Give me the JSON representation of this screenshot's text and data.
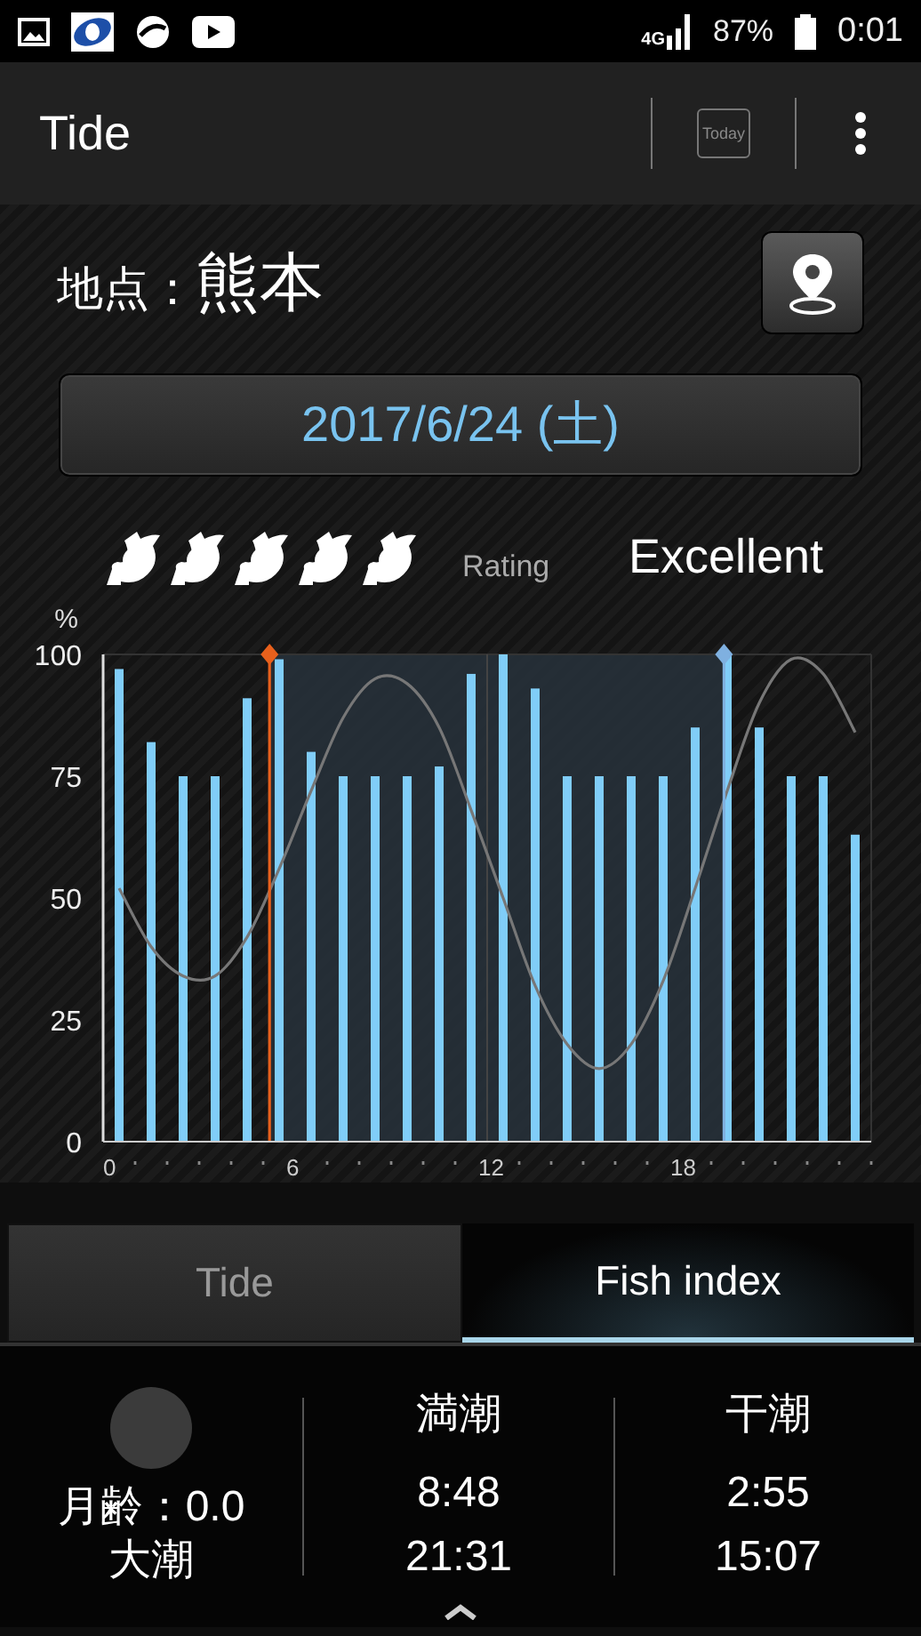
{
  "status_bar": {
    "network": "4G",
    "battery": "87%",
    "time": "0:01"
  },
  "app_bar": {
    "title": "Tide",
    "today_button": "Today"
  },
  "location": {
    "label": "地点：",
    "name": "熊本"
  },
  "date": "2017/6/24 (土)",
  "rating": {
    "stars": 5,
    "label": "Rating",
    "value": "Excellent"
  },
  "chart": {
    "unit": "%",
    "chart_data": {
      "type": "bar",
      "x": [
        0.5,
        1.5,
        2.5,
        3.5,
        4.5,
        5.5,
        6.5,
        7.5,
        8.5,
        9.5,
        10.5,
        11.5,
        12.5,
        13.5,
        14.5,
        15.5,
        16.5,
        17.5,
        18.5,
        19.5,
        20.5,
        21.5,
        22.5,
        23.5
      ],
      "series": [
        {
          "color": "#80cdf8",
          "values": [
            97,
            82,
            75,
            75,
            91,
            99,
            80,
            75,
            75,
            75,
            77,
            96,
            100,
            93,
            75,
            75,
            75,
            75,
            85,
            100,
            85,
            75,
            75,
            63
          ]
        },
        {
          "type": "line",
          "color": "#777777",
          "values": [
            52,
            40,
            34,
            34,
            42,
            56,
            72,
            87,
            95,
            94,
            85,
            68,
            50,
            32,
            20,
            15,
            20,
            33,
            52,
            72,
            90,
            99,
            96,
            84
          ]
        }
      ],
      "xlim": [
        0,
        24
      ],
      "ylim": [
        0,
        100
      ],
      "xticks": [
        0,
        6,
        12,
        18
      ],
      "yticks": [
        0,
        25,
        50,
        75,
        100
      ],
      "bands": [
        {
          "axis": "x",
          "from": 5.2,
          "to": 19.4
        }
      ],
      "ref_lines": [
        {
          "axis": "x",
          "value": 5.2,
          "color": "#e8601c"
        },
        {
          "axis": "x",
          "value": 19.4,
          "color": "#7fb0e0"
        }
      ]
    }
  },
  "tabs": [
    {
      "label": "Tide",
      "selected": false
    },
    {
      "label": "Fish index",
      "selected": true
    }
  ],
  "moon": {
    "age": "月齢：0.0",
    "tide_type": "大潮"
  },
  "high_tide": {
    "label": "満潮",
    "times": [
      "8:48",
      "21:31"
    ]
  },
  "low_tide": {
    "label": "干潮",
    "times": [
      "2:55",
      "15:07"
    ]
  }
}
